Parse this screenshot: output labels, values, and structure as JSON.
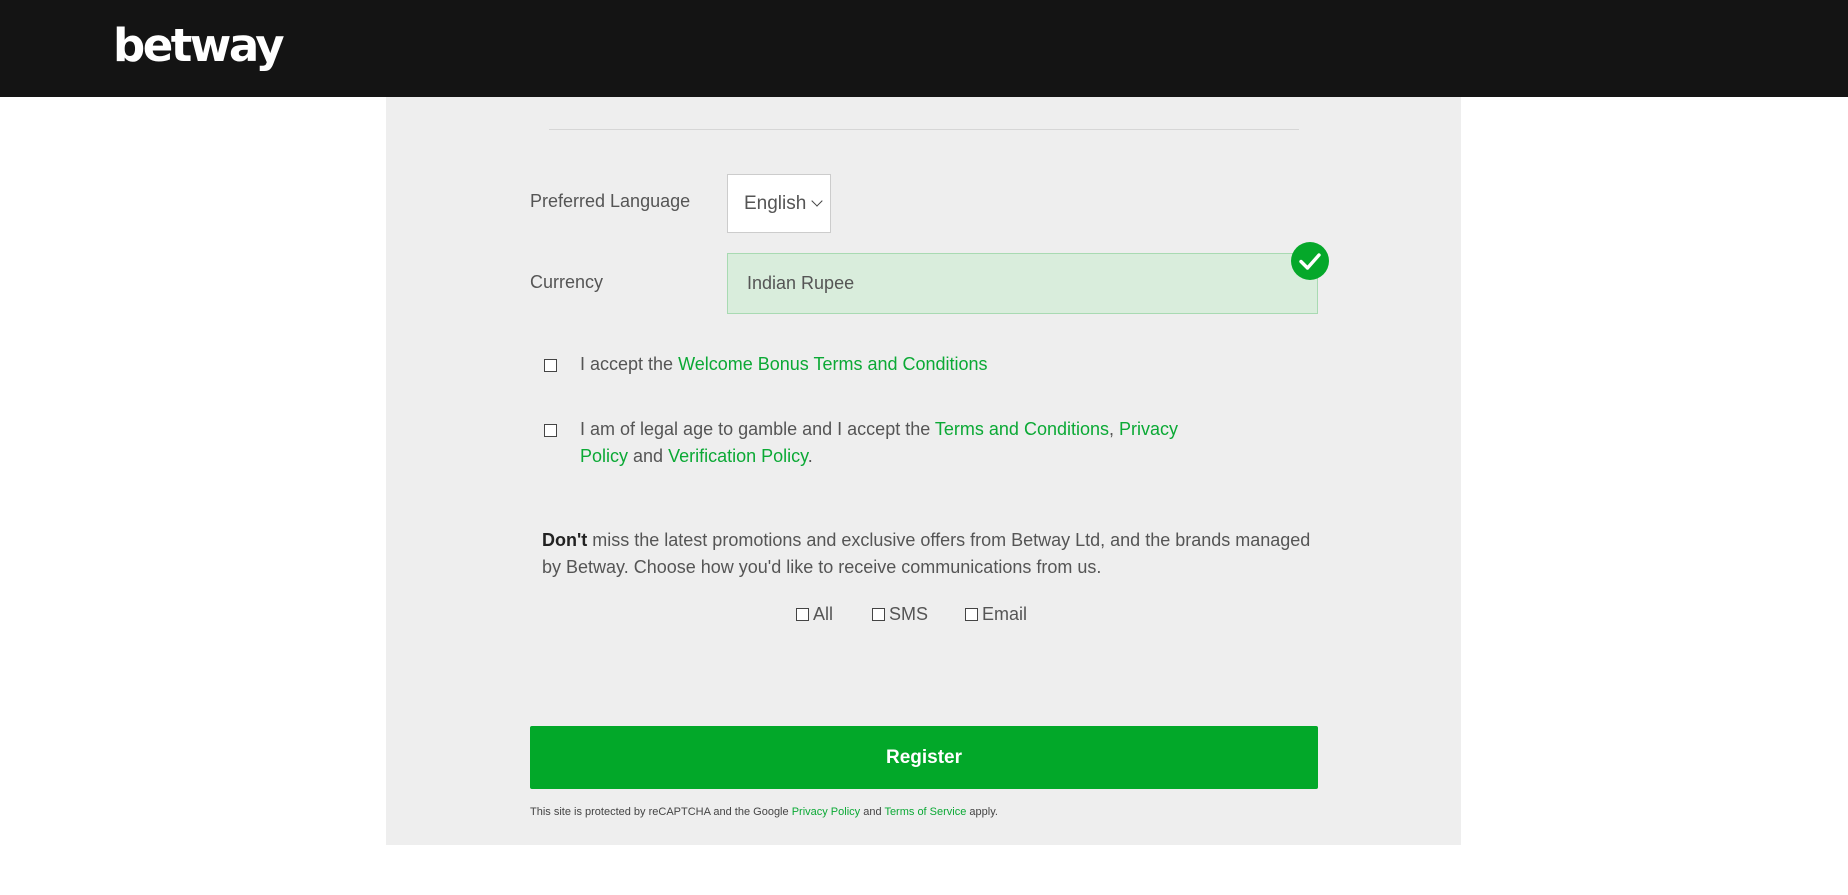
{
  "header": {
    "logo_text": "betway"
  },
  "form": {
    "language": {
      "label": "Preferred Language",
      "value": "English"
    },
    "currency": {
      "label": "Currency",
      "value": "Indian Rupee",
      "status": "valid"
    },
    "bonus_consent": {
      "prefix": "I accept the ",
      "link": "Welcome Bonus Terms and Conditions"
    },
    "age_consent": {
      "prefix": "I am of legal age to gamble and I accept the ",
      "terms_link": "Terms and Conditions",
      "sep": ", ",
      "privacy_link_1": "Privacy",
      "privacy_link_2": "Policy",
      "and": " and ",
      "verification_link": "Verification Policy",
      "end": "."
    },
    "promo": {
      "bold": "Don't",
      "text": " miss the latest promotions and exclusive offers from Betway Ltd, and the brands managed by Betway. Choose how you'd like to receive communications from us.",
      "options": {
        "all": "All",
        "sms": "SMS",
        "email": "Email"
      }
    },
    "register_label": "Register",
    "recaptcha": {
      "prefix": "This site is protected by reCAPTCHA and the Google ",
      "privacy_link": "Privacy Policy",
      "and": " and ",
      "terms_link": "Terms of Service",
      "suffix": " apply."
    }
  },
  "colors": {
    "accent": "#02a829",
    "header_bg": "#141414",
    "panel_bg": "#eeeeee"
  }
}
